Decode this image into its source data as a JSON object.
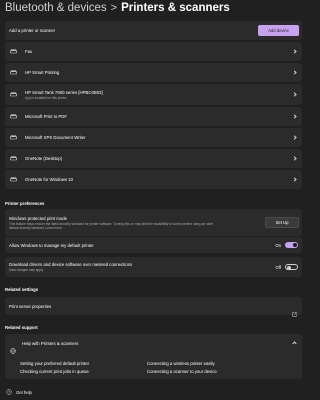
{
  "breadcrumb": {
    "parent": "Bluetooth & devices",
    "separator": ">",
    "current": "Printers & scanners"
  },
  "add_printer": {
    "label": "Add a printer or scanner",
    "button": "Add device"
  },
  "printers": [
    {
      "name": "Fax",
      "sub": ""
    },
    {
      "name": "HP Smart Printing",
      "sub": ""
    },
    {
      "name": "HP Smart Tank 7600 series [HPBC0B03]",
      "sub": "App is installed for this printer"
    },
    {
      "name": "Microsoft Print to PDF",
      "sub": ""
    },
    {
      "name": "Microsoft XPS Document Writer",
      "sub": ""
    },
    {
      "name": "OneNote (Desktop)",
      "sub": ""
    },
    {
      "name": "OneNote for Windows 10",
      "sub": ""
    }
  ],
  "preferences": {
    "heading": "Printer preferences",
    "protected": {
      "title": "Windows protected print mode",
      "desc1": "This feature helps ensure the latest security standard for printer software. Turning this on may limit the availability of some printers using an older",
      "desc2": "default security standard. Learn more.",
      "button": "Set Up"
    },
    "manage_default": {
      "title": "Allow Windows to manage my default printer",
      "state": "On"
    },
    "metered": {
      "title": "Download drivers and device software over metered connections",
      "sub": "Data charges may apply",
      "state": "Off"
    }
  },
  "related_settings": {
    "heading": "Related settings",
    "item": "Print server properties"
  },
  "related_support": {
    "heading": "Related support",
    "help_title": "Help with Printers & scanners",
    "links": [
      "Setting your preferred default printer",
      "Connecting a wireless printer easily",
      "Checking current print jobs in queue",
      "Connecting a scanner to your device"
    ]
  },
  "get_help": "Get help",
  "colors": {
    "accent": "#c8a2f0",
    "card": "#2b2b2b",
    "background": "#202020"
  }
}
